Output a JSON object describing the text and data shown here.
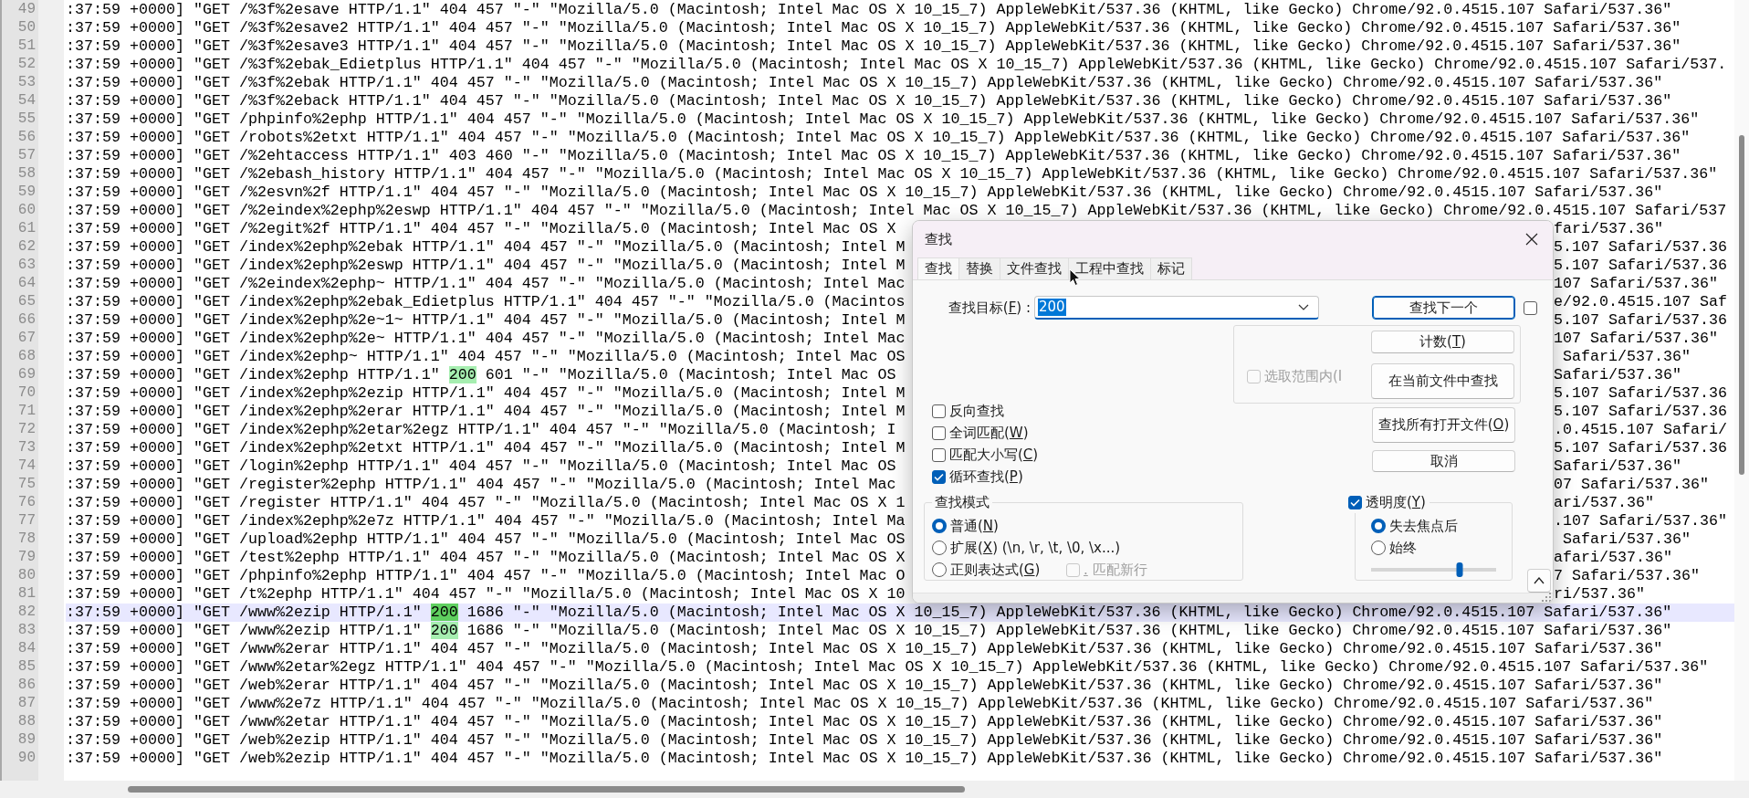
{
  "editor": {
    "lines": [
      {
        "number": "49",
        "current": false,
        "parts": [
          {
            "kind": "plain",
            "text": ":37:59 +0000] \"GET /%3f%2esave HTTP/1.1\" 404 457 \"-\" \"Mozilla/5.0 (Macintosh; Intel Mac OS X 10_15_7) AppleWebKit/537.36 (KHTML, like Gecko) Chrome/92.0.4515.107 Safari/537.36\""
          }
        ]
      },
      {
        "number": "50",
        "current": false,
        "parts": [
          {
            "kind": "plain",
            "text": ":37:59 +0000] \"GET /%3f%2esave2 HTTP/1.1\" 404 457 \"-\" \"Mozilla/5.0 (Macintosh; Intel Mac OS X 10_15_7) AppleWebKit/537.36 (KHTML, like Gecko) Chrome/92.0.4515.107 Safari/537.36\""
          }
        ]
      },
      {
        "number": "51",
        "current": false,
        "parts": [
          {
            "kind": "plain",
            "text": ":37:59 +0000] \"GET /%3f%2esave3 HTTP/1.1\" 404 457 \"-\" \"Mozilla/5.0 (Macintosh; Intel Mac OS X 10_15_7) AppleWebKit/537.36 (KHTML, like Gecko) Chrome/92.0.4515.107 Safari/537.36\""
          }
        ]
      },
      {
        "number": "52",
        "current": false,
        "parts": [
          {
            "kind": "plain",
            "text": ":37:59 +0000] \"GET /%3f%2ebak_Edietplus HTTP/1.1\" 404 457 \"-\" \"Mozilla/5.0 (Macintosh; Intel Mac OS X 10_15_7) AppleWebKit/537.36 (KHTML, like Gecko) Chrome/92.0.4515.107 Safari/537."
          }
        ]
      },
      {
        "number": "53",
        "current": false,
        "parts": [
          {
            "kind": "plain",
            "text": ":37:59 +0000] \"GET /%3f%2ebak HTTP/1.1\" 404 457 \"-\" \"Mozilla/5.0 (Macintosh; Intel Mac OS X 10_15_7) AppleWebKit/537.36 (KHTML, like Gecko) Chrome/92.0.4515.107 Safari/537.36\""
          }
        ]
      },
      {
        "number": "54",
        "current": false,
        "parts": [
          {
            "kind": "plain",
            "text": ":37:59 +0000] \"GET /%3f%2eback HTTP/1.1\" 404 457 \"-\" \"Mozilla/5.0 (Macintosh; Intel Mac OS X 10_15_7) AppleWebKit/537.36 (KHTML, like Gecko) Chrome/92.0.4515.107 Safari/537.36\""
          }
        ]
      },
      {
        "number": "55",
        "current": false,
        "parts": [
          {
            "kind": "plain",
            "text": ":37:59 +0000] \"GET /phpinfo%2ephp HTTP/1.1\" 404 457 \"-\" \"Mozilla/5.0 (Macintosh; Intel Mac OS X 10_15_7) AppleWebKit/537.36 (KHTML, like Gecko) Chrome/92.0.4515.107 Safari/537.36\""
          }
        ]
      },
      {
        "number": "56",
        "current": false,
        "parts": [
          {
            "kind": "plain",
            "text": ":37:59 +0000] \"GET /robots%2etxt HTTP/1.1\" 404 457 \"-\" \"Mozilla/5.0 (Macintosh; Intel Mac OS X 10_15_7) AppleWebKit/537.36 (KHTML, like Gecko) Chrome/92.0.4515.107 Safari/537.36\""
          }
        ]
      },
      {
        "number": "57",
        "current": false,
        "parts": [
          {
            "kind": "plain",
            "text": ":37:59 +0000] \"GET /%2ehtaccess HTTP/1.1\" 403 460 \"-\" \"Mozilla/5.0 (Macintosh; Intel Mac OS X 10_15_7) AppleWebKit/537.36 (KHTML, like Gecko) Chrome/92.0.4515.107 Safari/537.36\""
          }
        ]
      },
      {
        "number": "58",
        "current": false,
        "parts": [
          {
            "kind": "plain",
            "text": ":37:59 +0000] \"GET /%2ebash_history HTTP/1.1\" 404 457 \"-\" \"Mozilla/5.0 (Macintosh; Intel Mac OS X 10_15_7) AppleWebKit/537.36 (KHTML, like Gecko) Chrome/92.0.4515.107 Safari/537.36\""
          }
        ]
      },
      {
        "number": "59",
        "current": false,
        "parts": [
          {
            "kind": "plain",
            "text": ":37:59 +0000] \"GET /%2esvn%2f HTTP/1.1\" 404 457 \"-\" \"Mozilla/5.0 (Macintosh; Intel Mac OS X 10_15_7) AppleWebKit/537.36 (KHTML, like Gecko) Chrome/92.0.4515.107 Safari/537.36\""
          }
        ]
      },
      {
        "number": "60",
        "current": false,
        "parts": [
          {
            "kind": "plain",
            "text": ":37:59 +0000] \"GET /%2eindex%2ephp%2eswp HTTP/1.1\" 404 457 \"-\" \"Mozilla/5.0 (Macintosh; Intel Mac OS X 10_15_7) AppleWebKit/537.36 (KHTML, like Gecko) Chrome/92.0.4515.107 Safari/537"
          }
        ]
      },
      {
        "number": "61",
        "current": false,
        "parts": [
          {
            "kind": "plain",
            "text": ":37:59 +0000] \"GET /%2egit%2f HTTP/1.1\" 404 457 \"-\" \"Mozilla/5.0 (Macintosh; Intel Mac OS X"
          }
        ],
        "right": "fari/537.36\""
      },
      {
        "number": "62",
        "current": false,
        "parts": [
          {
            "kind": "plain",
            "text": ":37:59 +0000] \"GET /index%2ephp%2ebak HTTP/1.1\" 404 457 \"-\" \"Mozilla/5.0 (Macintosh; Intel M"
          }
        ],
        "right": "5.107 Safari/537.36"
      },
      {
        "number": "63",
        "current": false,
        "parts": [
          {
            "kind": "plain",
            "text": ":37:59 +0000] \"GET /index%2ephp%2eswp HTTP/1.1\" 404 457 \"-\" \"Mozilla/5.0 (Macintosh; Intel M"
          }
        ],
        "right": "5.107 Safari/537.36"
      },
      {
        "number": "64",
        "current": false,
        "parts": [
          {
            "kind": "plain",
            "text": ":37:59 +0000] \"GET /%2eindex%2ephp~ HTTP/1.1\" 404 457 \"-\" \"Mozilla/5.0 (Macintosh; Intel Mac"
          }
        ],
        "right": "107 Safari/537.36\""
      },
      {
        "number": "65",
        "current": false,
        "parts": [
          {
            "kind": "plain",
            "text": ":37:59 +0000] \"GET /index%2ephp%2ebak_Edietplus HTTP/1.1\" 404 457 \"-\" \"Mozilla/5.0 (Macintos"
          }
        ],
        "right": "e/92.0.4515.107 Saf"
      },
      {
        "number": "66",
        "current": false,
        "parts": [
          {
            "kind": "plain",
            "text": ":37:59 +0000] \"GET /index%2ephp%2e~1~ HTTP/1.1\" 404 457 \"-\" \"Mozilla/5.0 (Macintosh; Intel M"
          }
        ],
        "right": "5.107 Safari/537.36"
      },
      {
        "number": "67",
        "current": false,
        "parts": [
          {
            "kind": "plain",
            "text": ":37:59 +0000] \"GET /index%2ephp%2e~ HTTP/1.1\" 404 457 \"-\" \"Mozilla/5.0 (Macintosh; Intel Mac"
          }
        ],
        "right": "107 Safari/537.36\""
      },
      {
        "number": "68",
        "current": false,
        "parts": [
          {
            "kind": "plain",
            "text": ":37:59 +0000] \"GET /index%2ephp~ HTTP/1.1\" 404 457 \"-\" \"Mozilla/5.0 (Macintosh; Intel Mac OS"
          }
        ],
        "right": " Safari/537.36\""
      },
      {
        "number": "69",
        "current": false,
        "parts": [
          {
            "kind": "plain",
            "text": ":37:59 +0000] \"GET /index%2ephp HTTP/1.1\" "
          },
          {
            "kind": "match",
            "text": "200"
          },
          {
            "kind": "plain",
            "text": " 601 \"-\" \"Mozilla/5.0 (Macintosh; Intel Mac OS"
          }
        ],
        "right": "Safari/537.36\""
      },
      {
        "number": "70",
        "current": false,
        "parts": [
          {
            "kind": "plain",
            "text": ":37:59 +0000] \"GET /index%2ephp%2ezip HTTP/1.1\" 404 457 \"-\" \"Mozilla/5.0 (Macintosh; Intel M"
          }
        ],
        "right": "5.107 Safari/537.36"
      },
      {
        "number": "71",
        "current": false,
        "parts": [
          {
            "kind": "plain",
            "text": ":37:59 +0000] \"GET /index%2ephp%2erar HTTP/1.1\" 404 457 \"-\" \"Mozilla/5.0 (Macintosh; Intel M"
          }
        ],
        "right": "5.107 Safari/537.36"
      },
      {
        "number": "72",
        "current": false,
        "parts": [
          {
            "kind": "plain",
            "text": ":37:59 +0000] \"GET /index%2ephp%2etar%2egz HTTP/1.1\" 404 457 \"-\" \"Mozilla/5.0 (Macintosh; I"
          }
        ],
        "right": ".0.4515.107 Safari/"
      },
      {
        "number": "73",
        "current": false,
        "parts": [
          {
            "kind": "plain",
            "text": ":37:59 +0000] \"GET /index%2ephp%2etxt HTTP/1.1\" 404 457 \"-\" \"Mozilla/5.0 (Macintosh; Intel M"
          }
        ],
        "right": "5.107 Safari/537.36"
      },
      {
        "number": "74",
        "current": false,
        "parts": [
          {
            "kind": "plain",
            "text": ":37:59 +0000] \"GET /login%2ephp HTTP/1.1\" 404 457 \"-\" \"Mozilla/5.0 (Macintosh; Intel Mac OS"
          }
        ],
        "right": "Safari/537.36\""
      },
      {
        "number": "75",
        "current": false,
        "parts": [
          {
            "kind": "plain",
            "text": ":37:59 +0000] \"GET /register%2ephp HTTP/1.1\" 404 457 \"-\" \"Mozilla/5.0 (Macintosh; Intel Mac"
          }
        ],
        "right": "07 Safari/537.36\""
      },
      {
        "number": "76",
        "current": false,
        "parts": [
          {
            "kind": "plain",
            "text": ":37:59 +0000] \"GET /register HTTP/1.1\" 404 457 \"-\" \"Mozilla/5.0 (Macintosh; Intel Mac OS X 1"
          }
        ],
        "right": "ari/537.36\""
      },
      {
        "number": "77",
        "current": false,
        "parts": [
          {
            "kind": "plain",
            "text": ":37:59 +0000] \"GET /index%2ephp%2e7z HTTP/1.1\" 404 457 \"-\" \"Mozilla/5.0 (Macintosh; Intel Ma"
          }
        ],
        "right": ".107 Safari/537.36\""
      },
      {
        "number": "78",
        "current": false,
        "parts": [
          {
            "kind": "plain",
            "text": ":37:59 +0000] \"GET /upload%2ephp HTTP/1.1\" 404 457 \"-\" \"Mozilla/5.0 (Macintosh; Intel Mac OS"
          }
        ],
        "right": " Safari/537.36\""
      },
      {
        "number": "79",
        "current": false,
        "parts": [
          {
            "kind": "plain",
            "text": ":37:59 +0000] \"GET /test%2ephp HTTP/1.1\" 404 457 \"-\" \"Mozilla/5.0 (Macintosh; Intel Mac OS X"
          }
        ],
        "right": "afari/537.36\""
      },
      {
        "number": "80",
        "current": false,
        "parts": [
          {
            "kind": "plain",
            "text": ":37:59 +0000] \"GET /phpinfo%2ephp HTTP/1.1\" 404 457 \"-\" \"Mozilla/5.0 (Macintosh; Intel Mac O"
          }
        ],
        "right": "7 Safari/537.36\""
      },
      {
        "number": "81",
        "current": false,
        "parts": [
          {
            "kind": "plain",
            "text": ":37:59 +0000] \"GET /t%2ephp HTTP/1.1\" 404 457 \"-\" \"Mozilla/5.0 (Macintosh; Intel Mac OS X 10"
          }
        ],
        "right": "ri/537.36\""
      },
      {
        "number": "82",
        "current": true,
        "parts": [
          {
            "kind": "plain",
            "text": ":37:59 +0000] \"GET /www%2ezip HTTP/1.1\" "
          },
          {
            "kind": "selected_match",
            "text": "200"
          },
          {
            "kind": "plain",
            "text": " 1686 \"-\" \"Mozilla/5.0 (Macintosh; Intel Mac OS X 10_15_7) AppleWebKit/537.36 (KHTML, like Gecko) Chrome/92.0.4515.107 Safari/537.36\""
          }
        ]
      },
      {
        "number": "83",
        "current": false,
        "parts": [
          {
            "kind": "plain",
            "text": ":37:59 +0000] \"GET /www%2ezip HTTP/1.1\" "
          },
          {
            "kind": "match",
            "text": "200"
          },
          {
            "kind": "plain",
            "text": " 1686 \"-\" \"Mozilla/5.0 (Macintosh; Intel Mac OS X 10_15_7) AppleWebKit/537.36 (KHTML, like Gecko) Chrome/92.0.4515.107 Safari/537.36\""
          }
        ]
      },
      {
        "number": "84",
        "current": false,
        "parts": [
          {
            "kind": "plain",
            "text": ":37:59 +0000] \"GET /www%2erar HTTP/1.1\" 404 457 \"-\" \"Mozilla/5.0 (Macintosh; Intel Mac OS X 10_15_7) AppleWebKit/537.36 (KHTML, like Gecko) Chrome/92.0.4515.107 Safari/537.36\""
          }
        ]
      },
      {
        "number": "85",
        "current": false,
        "parts": [
          {
            "kind": "plain",
            "text": ":37:59 +0000] \"GET /www%2etar%2egz HTTP/1.1\" 404 457 \"-\" \"Mozilla/5.0 (Macintosh; Intel Mac OS X 10_15_7) AppleWebKit/537.36 (KHTML, like Gecko) Chrome/92.0.4515.107 Safari/537.36\""
          }
        ]
      },
      {
        "number": "86",
        "current": false,
        "parts": [
          {
            "kind": "plain",
            "text": ":37:59 +0000] \"GET /web%2erar HTTP/1.1\" 404 457 \"-\" \"Mozilla/5.0 (Macintosh; Intel Mac OS X 10_15_7) AppleWebKit/537.36 (KHTML, like Gecko) Chrome/92.0.4515.107 Safari/537.36\""
          }
        ]
      },
      {
        "number": "87",
        "current": false,
        "parts": [
          {
            "kind": "plain",
            "text": ":37:59 +0000] \"GET /www%2e7z HTTP/1.1\" 404 457 \"-\" \"Mozilla/5.0 (Macintosh; Intel Mac OS X 10_15_7) AppleWebKit/537.36 (KHTML, like Gecko) Chrome/92.0.4515.107 Safari/537.36\""
          }
        ]
      },
      {
        "number": "88",
        "current": false,
        "parts": [
          {
            "kind": "plain",
            "text": ":37:59 +0000] \"GET /www%2etar HTTP/1.1\" 404 457 \"-\" \"Mozilla/5.0 (Macintosh; Intel Mac OS X 10_15_7) AppleWebKit/537.36 (KHTML, like Gecko) Chrome/92.0.4515.107 Safari/537.36\""
          }
        ]
      },
      {
        "number": "89",
        "current": false,
        "parts": [
          {
            "kind": "plain",
            "text": ":37:59 +0000] \"GET /web%2ezip HTTP/1.1\" 404 457 \"-\" \"Mozilla/5.0 (Macintosh; Intel Mac OS X 10_15_7) AppleWebKit/537.36 (KHTML, like Gecko) Chrome/92.0.4515.107 Safari/537.36\""
          }
        ]
      },
      {
        "number": "90",
        "current": false,
        "parts": [
          {
            "kind": "plain",
            "text": ":37:59 +0000] \"GET /web%2ezip HTTP/1.1\" 404 457 \"-\" \"Mozilla/5.0 (Macintosh; Intel Mac OS X 10_15_7) AppleWebKit/537.36 (KHTML, like Gecko) Chrome/92.0.4515.107 Safari/537.36\""
          }
        ]
      }
    ]
  },
  "find_dialog": {
    "title": "查找",
    "tabs": [
      {
        "label": "查找",
        "selected": true
      },
      {
        "label": "替换",
        "selected": false
      },
      {
        "label": "文件查找",
        "selected": false
      },
      {
        "label": "工程中查找",
        "selected": false
      },
      {
        "label": "标记",
        "selected": false
      }
    ],
    "target": {
      "label": "查找目标(F) :",
      "hotkey": true,
      "value": "200"
    },
    "find_next_button": {
      "label": "查找下一个",
      "default": true
    },
    "extra_checkbox": {
      "checked": false
    },
    "in_selection": {
      "label": "选取范围内(I",
      "checked": false,
      "disabled": true
    },
    "count_button": {
      "label": "计数(T)",
      "hotkey": true
    },
    "find_in_current_button": {
      "label": "在当前文件中查找"
    },
    "find_all_open_button": {
      "label": "查找所有打开文件(O)",
      "hotkey": true
    },
    "cancel_button": {
      "label": "取消"
    },
    "options": [
      {
        "label": "反向查找",
        "hotkey": false,
        "checked": false
      },
      {
        "label": "全词匹配(W)",
        "hotkey": true,
        "checked": false
      },
      {
        "label": "匹配大小写(C)",
        "hotkey": true,
        "checked": false
      },
      {
        "label": "循环查找(P)",
        "hotkey": true,
        "checked": true
      }
    ],
    "search_mode": {
      "title": "查找模式",
      "modes": [
        {
          "label": "普通(N)",
          "hotkey": true,
          "selected": true
        },
        {
          "label": "扩展(X) (\\n, \\r, \\t, \\0, \\x...)",
          "hotkey": true,
          "selected": false
        },
        {
          "label": "正则表达式(G)",
          "hotkey": true,
          "selected": false
        }
      ],
      "dot_newline": {
        "label": ". 匹配新行",
        "hotkey": true,
        "checked": false,
        "disabled": true
      }
    },
    "transparency": {
      "label": "透明度(Y)",
      "hotkey": true,
      "checked": true,
      "modes": [
        {
          "label": "失去焦点后",
          "selected": true
        },
        {
          "label": "始终",
          "selected": false
        }
      ],
      "level": 0.71
    }
  }
}
